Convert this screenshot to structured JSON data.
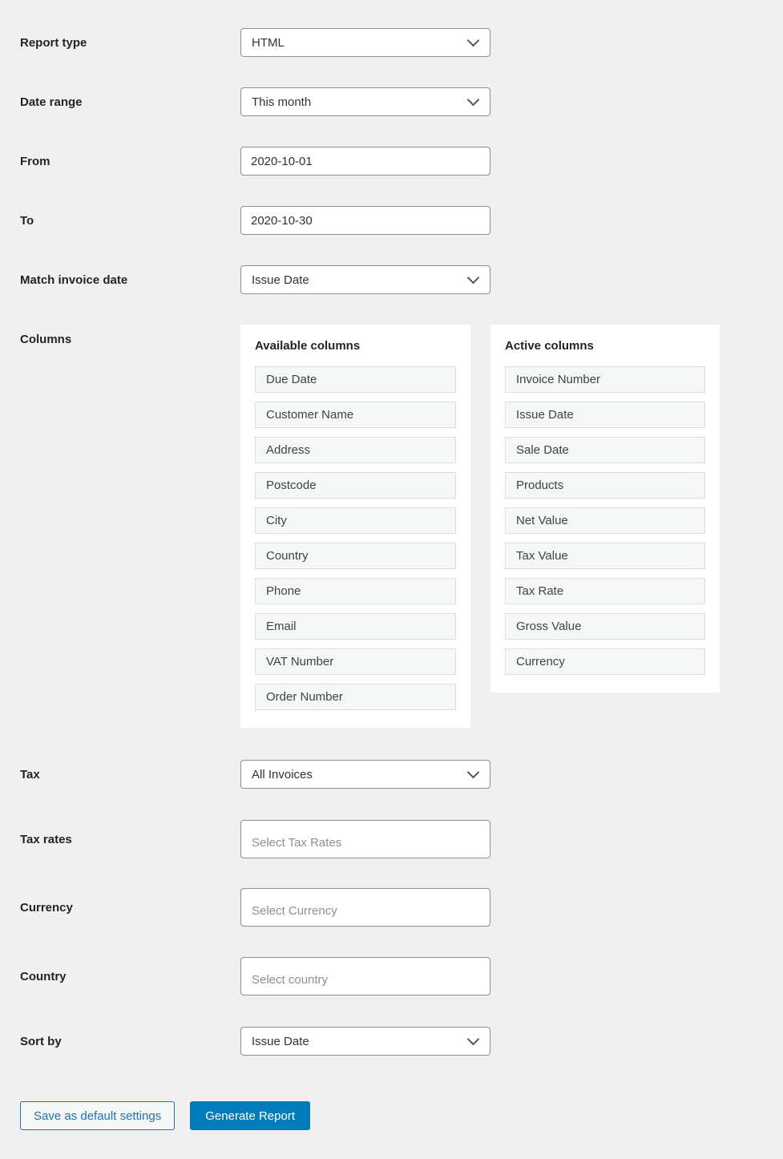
{
  "colors": {
    "page_bg": "#f0f0f1",
    "panel_bg": "#ffffff",
    "field_border": "#8c8f94",
    "field_text": "#2c3338",
    "label_text": "#1d2327",
    "placeholder_text": "#8c8f94",
    "chip_bg": "#f6f7f7",
    "chip_border": "#dcdcde",
    "chip_text": "#3c434a",
    "primary_button_bg": "#007cba",
    "primary_button_text": "#ffffff",
    "secondary_button_border": "#2271b1",
    "secondary_button_text": "#2271b1"
  },
  "rows": {
    "report_type": {
      "label": "Report type",
      "value": "HTML"
    },
    "date_range": {
      "label": "Date range",
      "value": "This month"
    },
    "from": {
      "label": "From",
      "value": "2020-10-01"
    },
    "to": {
      "label": "To",
      "value": "2020-10-30"
    },
    "match_invoice_date": {
      "label": "Match invoice date",
      "value": "Issue Date"
    },
    "tax": {
      "label": "Tax",
      "value": "All Invoices"
    },
    "tax_rates": {
      "label": "Tax rates",
      "placeholder": "Select Tax Rates"
    },
    "currency": {
      "label": "Currency",
      "placeholder": "Select Currency"
    },
    "country": {
      "label": "Country",
      "placeholder": "Select country"
    },
    "sort_by": {
      "label": "Sort by",
      "value": "Issue Date"
    }
  },
  "columns": {
    "label": "Columns",
    "available": {
      "title": "Available columns",
      "items": [
        "Due Date",
        "Customer Name",
        "Address",
        "Postcode",
        "City",
        "Country",
        "Phone",
        "Email",
        "VAT Number",
        "Order Number"
      ]
    },
    "active": {
      "title": "Active columns",
      "items": [
        "Invoice Number",
        "Issue Date",
        "Sale Date",
        "Products",
        "Net Value",
        "Tax Value",
        "Tax Rate",
        "Gross Value",
        "Currency"
      ]
    }
  },
  "buttons": {
    "save": "Save as default settings",
    "generate": "Generate Report"
  }
}
